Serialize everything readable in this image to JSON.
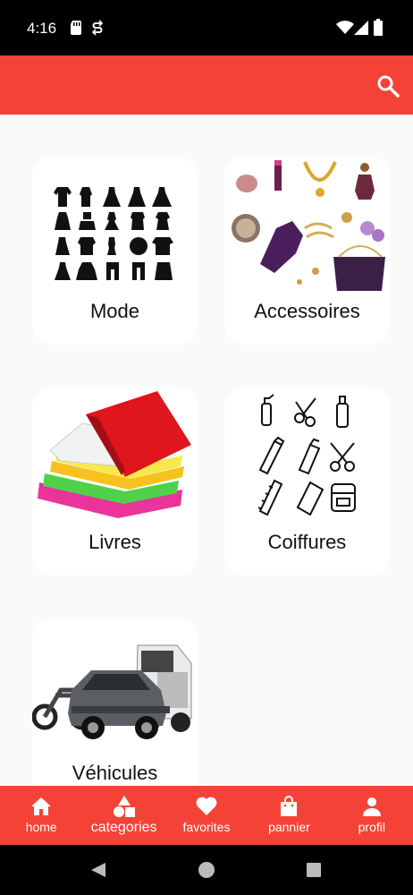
{
  "status_bar": {
    "time": "4:16",
    "icons": [
      "sd-card-icon",
      "sync-icon",
      "wifi-icon",
      "signal-icon",
      "battery-icon"
    ]
  },
  "app_bar": {
    "color": "#f44336",
    "action_icon": "search-icon"
  },
  "categories": [
    {
      "label": "Mode",
      "icon": "clothing-silhouettes"
    },
    {
      "label": "Accessoires",
      "icon": "accessories-collage"
    },
    {
      "label": "Livres",
      "icon": "books-stack"
    },
    {
      "label": "Coiffures",
      "icon": "hairdressing-tools"
    },
    {
      "label": "Véhicules",
      "icon": "vehicles-motorbike-car-truck"
    }
  ],
  "bottom_nav": {
    "items": [
      {
        "label": "home",
        "icon": "home-icon"
      },
      {
        "label": "categories",
        "icon": "shapes-icon"
      },
      {
        "label": "favorites",
        "icon": "heart-icon"
      },
      {
        "label": "pannier",
        "icon": "shopping-bag-icon"
      },
      {
        "label": "profil",
        "icon": "person-icon"
      }
    ]
  },
  "system_nav": [
    "back-icon",
    "home-circle-icon",
    "recents-icon"
  ]
}
